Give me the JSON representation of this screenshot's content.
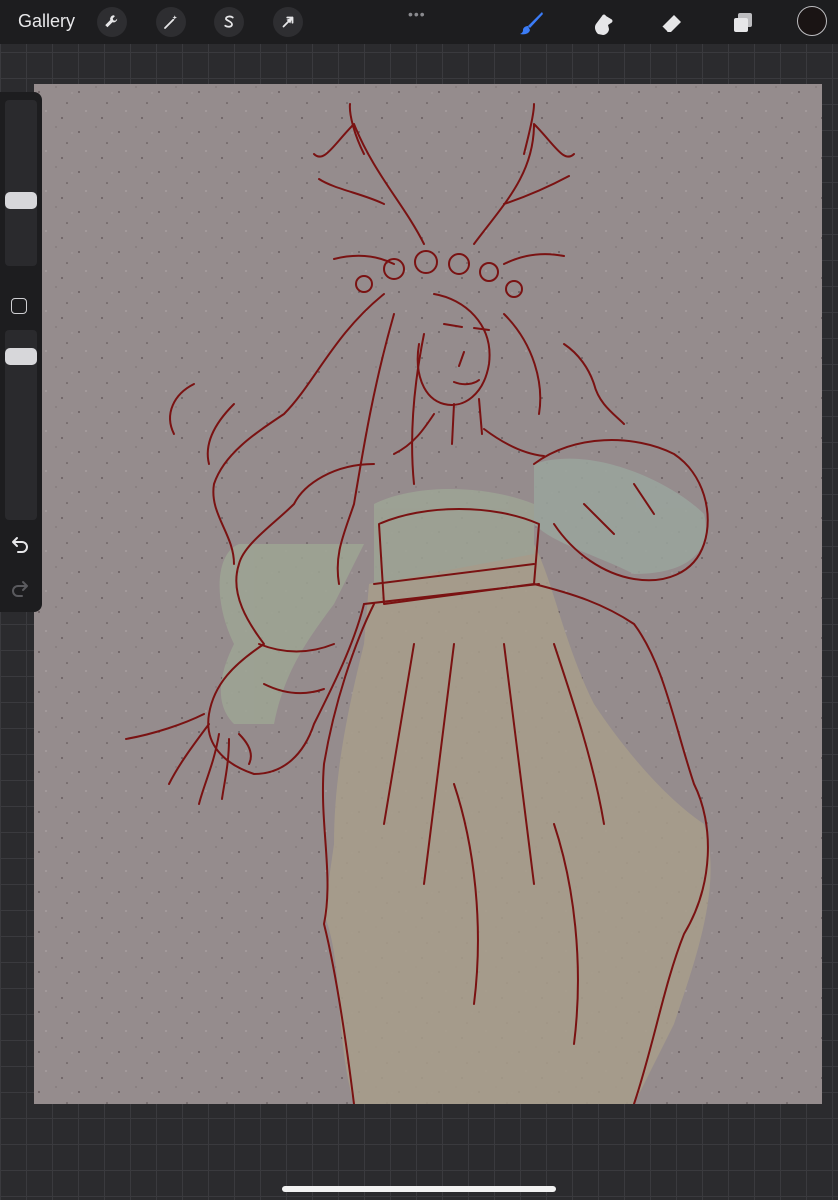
{
  "topbar": {
    "gallery_label": "Gallery",
    "more_label": "•••",
    "active_tool": "brush",
    "current_color": "#1a1414",
    "accent_color": "#3b7cf7"
  },
  "sidebar": {
    "brush_size_level": 0.35,
    "opacity_level": 0.06
  },
  "canvas": {
    "paper_color": "#958c8d",
    "line_color": "#7a1212"
  }
}
